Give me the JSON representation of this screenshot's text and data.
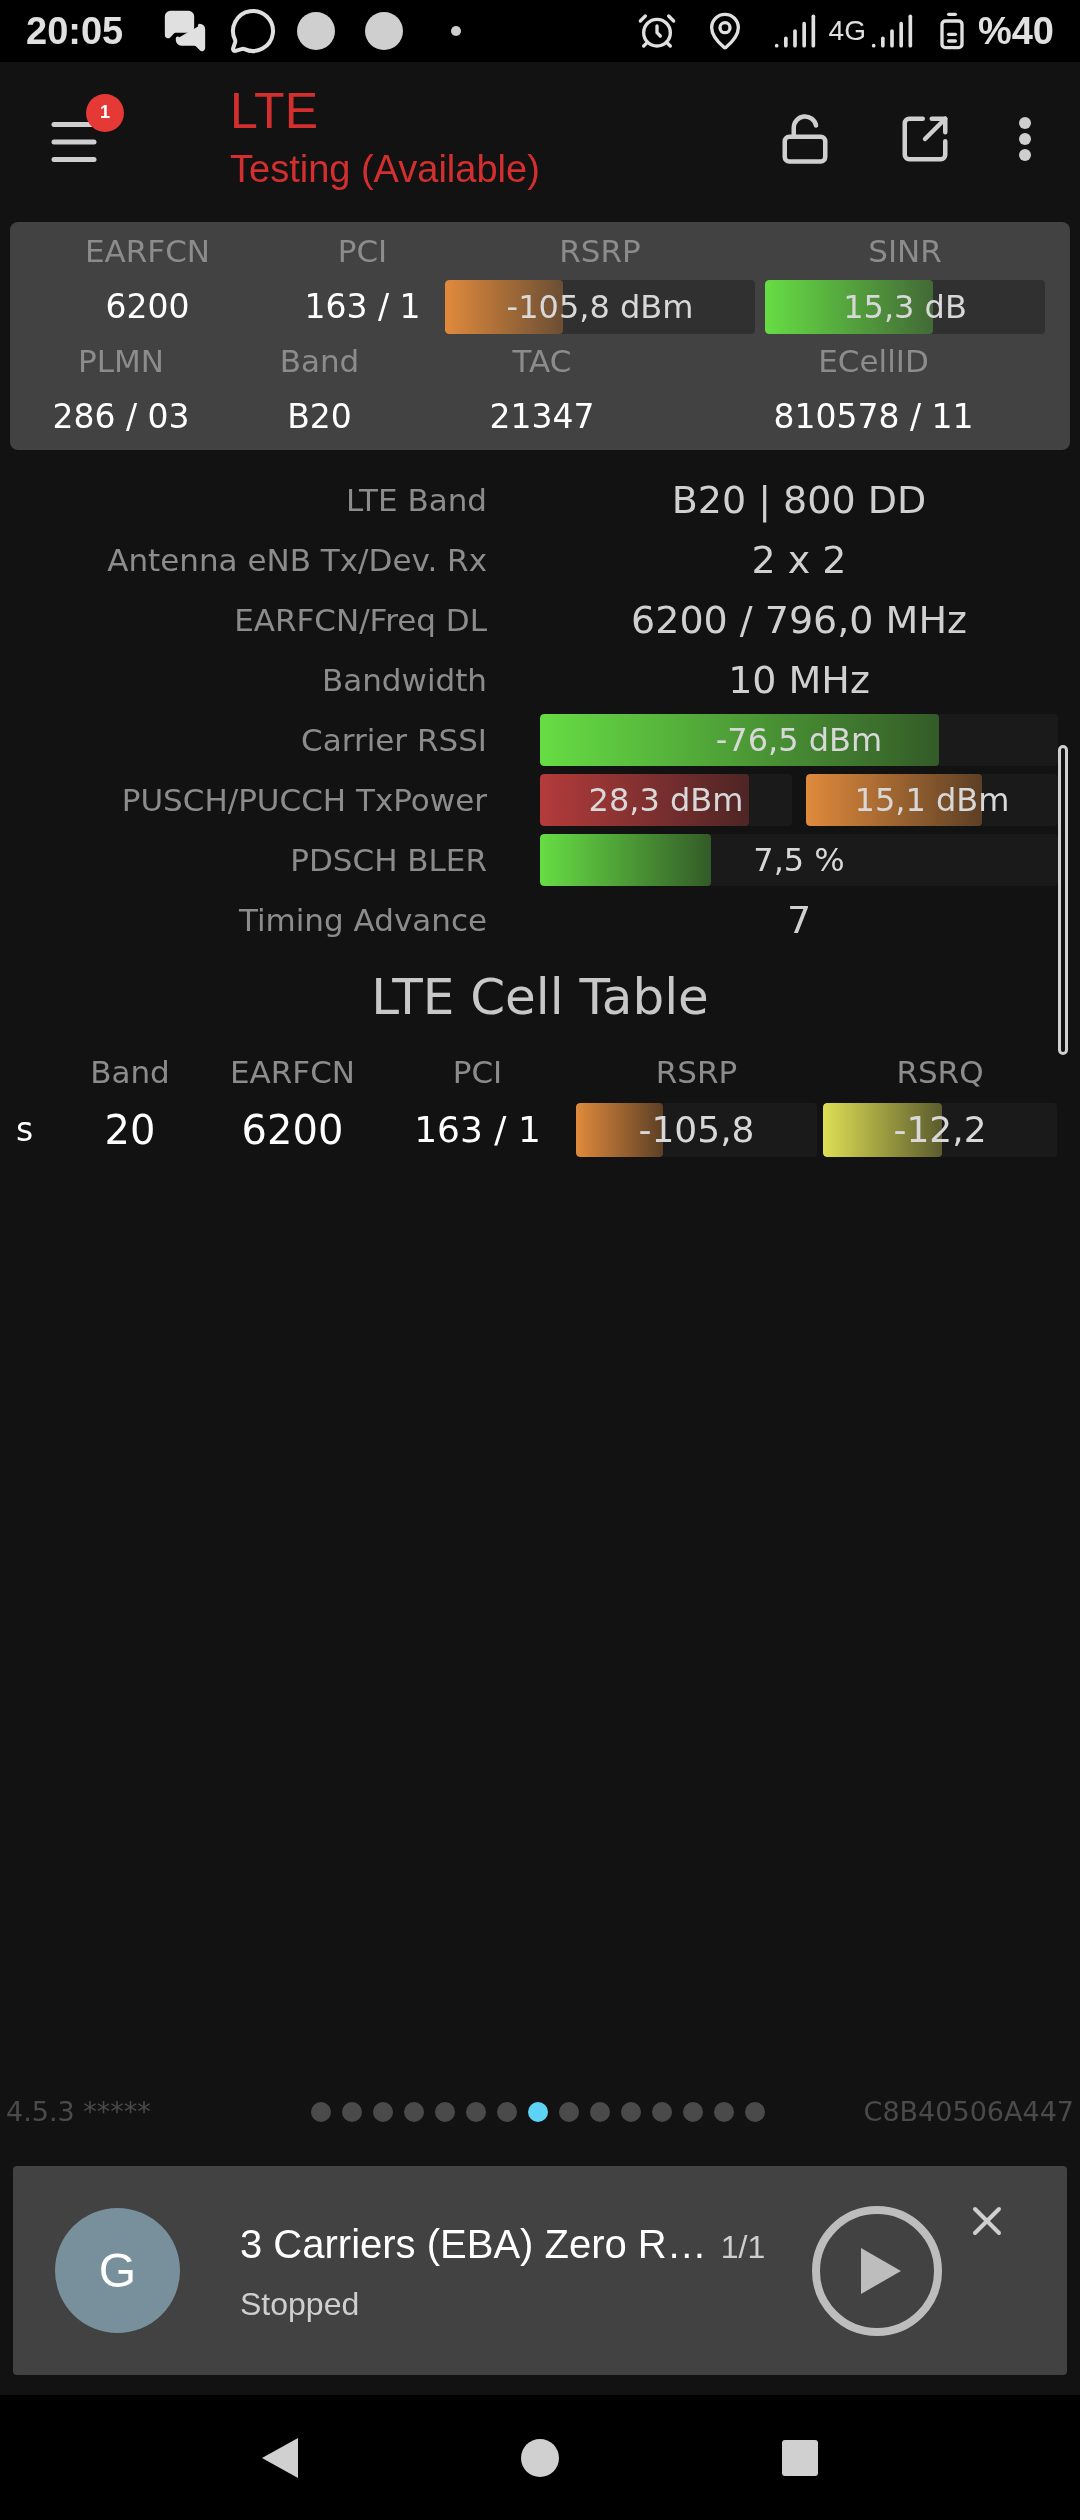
{
  "status_bar": {
    "time": "20:05",
    "network": "4G",
    "battery": "%40"
  },
  "header": {
    "menu_badge": "1",
    "title": "LTE",
    "subtitle": "Testing (Available)"
  },
  "summary": {
    "top": [
      {
        "kind": "text",
        "label": "EARFCN",
        "value": "6200"
      },
      {
        "kind": "text",
        "label": "PCI",
        "value": "163 / 1"
      },
      {
        "kind": "bar",
        "label": "RSRP",
        "value": "-105,8 dBm",
        "level": 0.38,
        "color": "#e08a3c"
      },
      {
        "kind": "bar",
        "label": "SINR",
        "value": "15,3 dB",
        "level": 0.6,
        "color": "#66dd44"
      }
    ],
    "bottom": [
      {
        "kind": "text",
        "label": "PLMN",
        "value": "286 / 03"
      },
      {
        "kind": "text",
        "label": "Band",
        "value": "B20"
      },
      {
        "kind": "text",
        "label": "TAC",
        "value": "21347"
      },
      {
        "kind": "text",
        "label": "ECellID",
        "value": "810578 / 11"
      }
    ]
  },
  "details": [
    {
      "kind": "text",
      "label": "LTE Band",
      "value": "B20 | 800 DD"
    },
    {
      "kind": "text",
      "label": "Antenna eNB Tx/Dev. Rx",
      "value": "2 x 2"
    },
    {
      "kind": "text",
      "label": "EARFCN/Freq DL",
      "value": "6200 / 796,0 MHz"
    },
    {
      "kind": "text",
      "label": "Bandwidth",
      "value": "10 MHz"
    },
    {
      "kind": "bars",
      "label": "Carrier RSSI",
      "bars": [
        {
          "reading": "-76,5 dBm",
          "level": 0.77,
          "color": "#66dd44"
        }
      ]
    },
    {
      "kind": "bars",
      "label": "PUSCH/PUCCH TxPower",
      "bars": [
        {
          "reading": "28,3 dBm",
          "level": 0.83,
          "color": "#b43b3b"
        },
        {
          "reading": "15,1 dBm",
          "level": 0.7,
          "color": "#e08a3c"
        }
      ]
    },
    {
      "kind": "bars",
      "label": "PDSCH BLER",
      "bars": [
        {
          "reading": "7,5 %",
          "level": 0.33,
          "color": "#66dd44"
        }
      ]
    },
    {
      "kind": "text",
      "label": "Timing Advance",
      "value": "7"
    }
  ],
  "cell_table": {
    "title": "LTE Cell Table",
    "columns": [
      "Band",
      "EARFCN",
      "PCI",
      "RSRP",
      "RSRQ"
    ],
    "rows": [
      {
        "type": "s",
        "cells": [
          {
            "kind": "text",
            "value": "20"
          },
          {
            "kind": "text",
            "value": "6200"
          },
          {
            "kind": "text",
            "value": "163 / 1"
          },
          {
            "kind": "bar",
            "value": "-105,8",
            "level": 0.36,
            "color": "#e08a3c"
          },
          {
            "kind": "bar",
            "value": "-12,2",
            "level": 0.51,
            "color": "#dede55"
          }
        ]
      }
    ]
  },
  "footer": {
    "version": "4.5.3 *****",
    "pages": [
      {
        "selected": false
      },
      {
        "selected": false
      },
      {
        "selected": false
      },
      {
        "selected": false
      },
      {
        "selected": false
      },
      {
        "selected": false
      },
      {
        "selected": false
      },
      {
        "selected": true
      },
      {
        "selected": false
      },
      {
        "selected": false
      },
      {
        "selected": false
      },
      {
        "selected": false
      },
      {
        "selected": false
      },
      {
        "selected": false
      },
      {
        "selected": false
      }
    ],
    "device_id": "C8B40506A447"
  },
  "notification": {
    "avatar": "G",
    "title": "3 Carriers (EBA) Zero R…",
    "count": "1/1",
    "status": "Stopped"
  }
}
